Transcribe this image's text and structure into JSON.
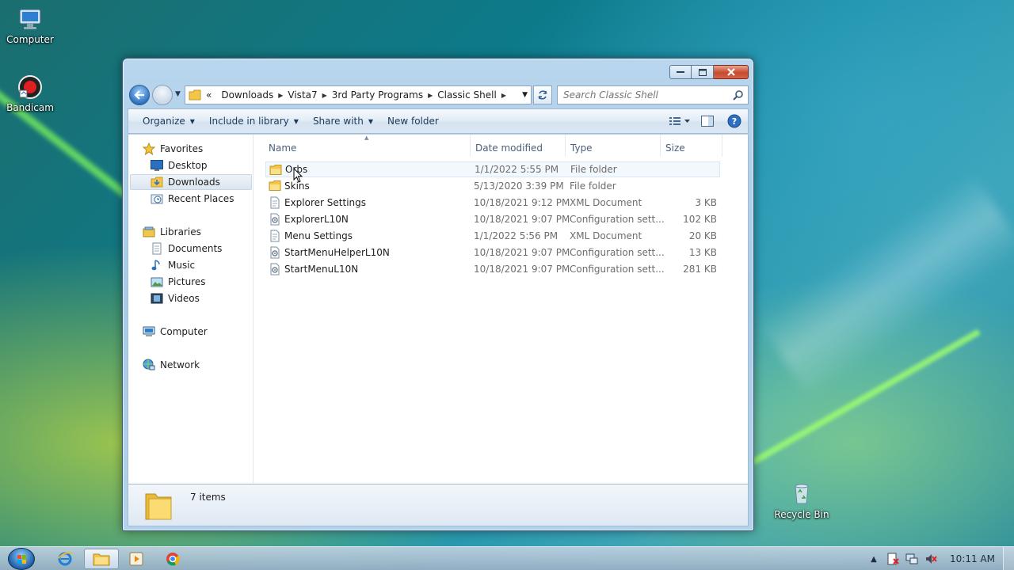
{
  "desktop": {
    "icons": [
      {
        "label": "Computer"
      },
      {
        "label": "Bandicam"
      },
      {
        "label": "Recycle Bin"
      }
    ]
  },
  "window": {
    "address": {
      "overflow": "«",
      "segments": [
        "Downloads",
        "Vista7",
        "3rd Party Programs",
        "Classic Shell"
      ]
    },
    "search": {
      "placeholder": "Search Classic Shell"
    },
    "commands": {
      "organize": "Organize",
      "include": "Include in library",
      "share": "Share with",
      "new_folder": "New folder"
    },
    "nav": {
      "favorites": "Favorites",
      "desktop": "Desktop",
      "downloads": "Downloads",
      "recent": "Recent Places",
      "libraries": "Libraries",
      "documents": "Documents",
      "music": "Music",
      "pictures": "Pictures",
      "videos": "Videos",
      "computer": "Computer",
      "network": "Network"
    },
    "columns": {
      "name": "Name",
      "date": "Date modified",
      "type": "Type",
      "size": "Size"
    },
    "files": [
      {
        "name": "Orbs",
        "date": "1/1/2022 5:55 PM",
        "type": "File folder",
        "size": "",
        "icon": "folder-icon"
      },
      {
        "name": "Skins",
        "date": "5/13/2020 3:39 PM",
        "type": "File folder",
        "size": "",
        "icon": "folder-icon"
      },
      {
        "name": "Explorer Settings",
        "date": "10/18/2021 9:12 PM",
        "type": "XML Document",
        "size": "3 KB",
        "icon": "xml-document-icon"
      },
      {
        "name": "ExplorerL10N",
        "date": "10/18/2021 9:07 PM",
        "type": "Configuration sett...",
        "size": "102 KB",
        "icon": "config-file-icon"
      },
      {
        "name": "Menu Settings",
        "date": "1/1/2022 5:56 PM",
        "type": "XML Document",
        "size": "20 KB",
        "icon": "xml-document-icon"
      },
      {
        "name": "StartMenuHelperL10N",
        "date": "10/18/2021 9:07 PM",
        "type": "Configuration sett...",
        "size": "13 KB",
        "icon": "config-file-icon"
      },
      {
        "name": "StartMenuL10N",
        "date": "10/18/2021 9:07 PM",
        "type": "Configuration sett...",
        "size": "281 KB",
        "icon": "config-file-icon"
      }
    ],
    "status": {
      "count": "7 items"
    }
  },
  "taskbar": {
    "clock": "10:11 AM",
    "tray_arrow": "▲"
  },
  "colors": {
    "accent": "#1e395b",
    "selection": "#dce6f0",
    "close_button": "#c74a2e"
  }
}
